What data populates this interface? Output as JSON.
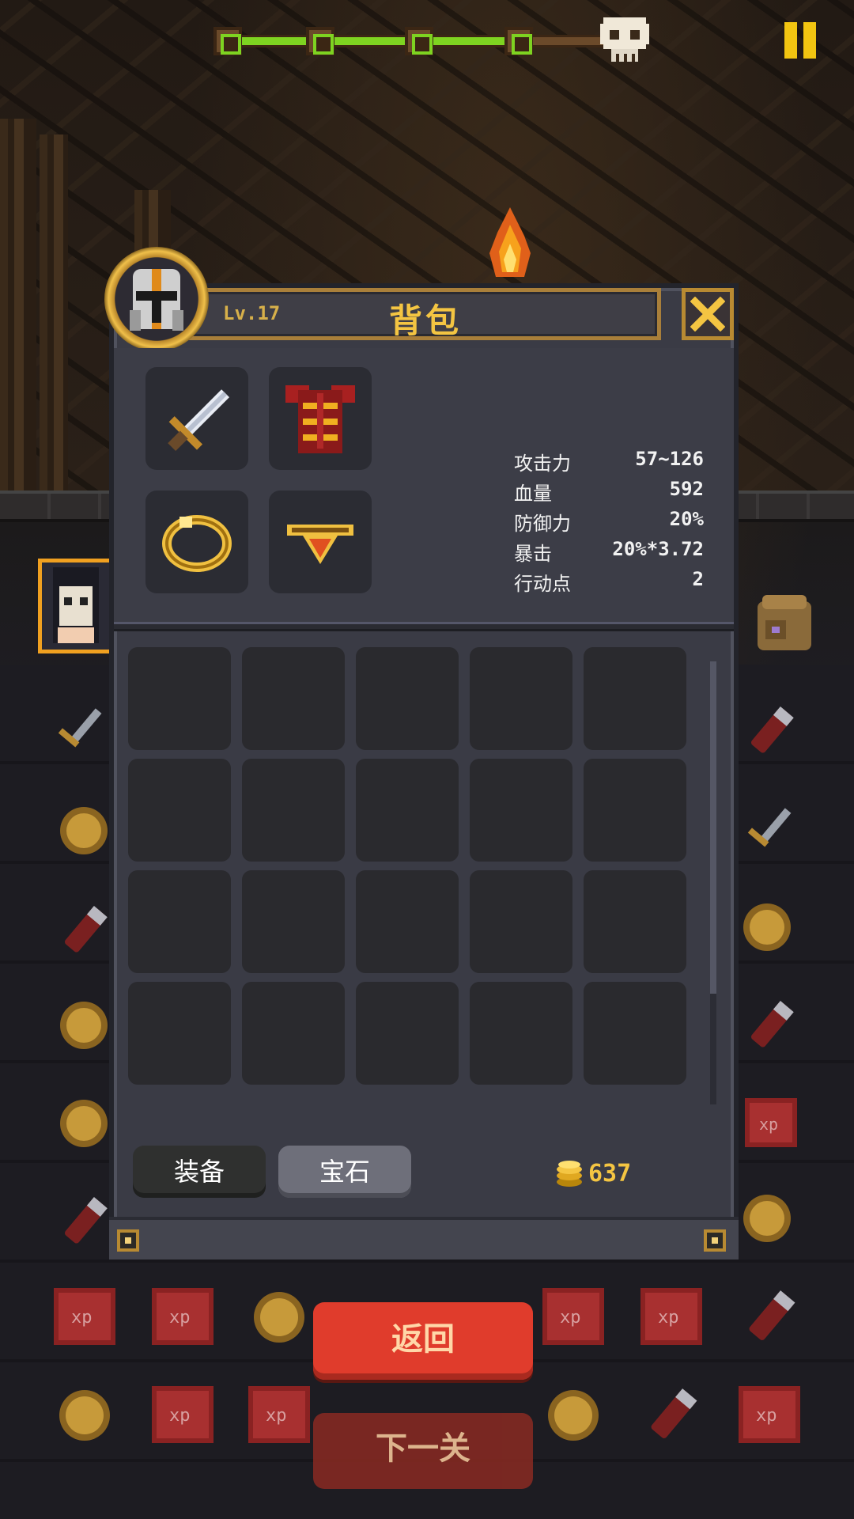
{
  "top_bar": {
    "stage_progress": {
      "nodes_total": 5,
      "nodes_reached": 4,
      "boss_icon": "skull-icon"
    },
    "pause_icon": "pause-icon"
  },
  "backpack": {
    "level": "Lv.17",
    "title": "背包",
    "close_icon": "close-x-icon",
    "avatar_icon": "knight-helmet-icon",
    "equipment_slots": [
      "sword-icon",
      "armor-icon",
      "ring-icon",
      "amulet-icon"
    ],
    "stats": [
      {
        "label": "攻击力",
        "value": "57~126"
      },
      {
        "label": "血量",
        "value": "592"
      },
      {
        "label": "防御力",
        "value": "20%"
      },
      {
        "label": "暴击",
        "value": "20%*3.72"
      },
      {
        "label": "行动点",
        "value": "2"
      }
    ],
    "inventory": {
      "rows": 4,
      "cols": 5,
      "items": []
    },
    "tabs": {
      "equip": "装备",
      "gem": "宝石",
      "active": "gem"
    },
    "gold": "637"
  },
  "buttons": {
    "back": "返回",
    "next_level": "下一关"
  },
  "colors": {
    "accent_gold": "#f4c542",
    "progress_green": "#7ed321",
    "back_red": "#e03c2c"
  }
}
